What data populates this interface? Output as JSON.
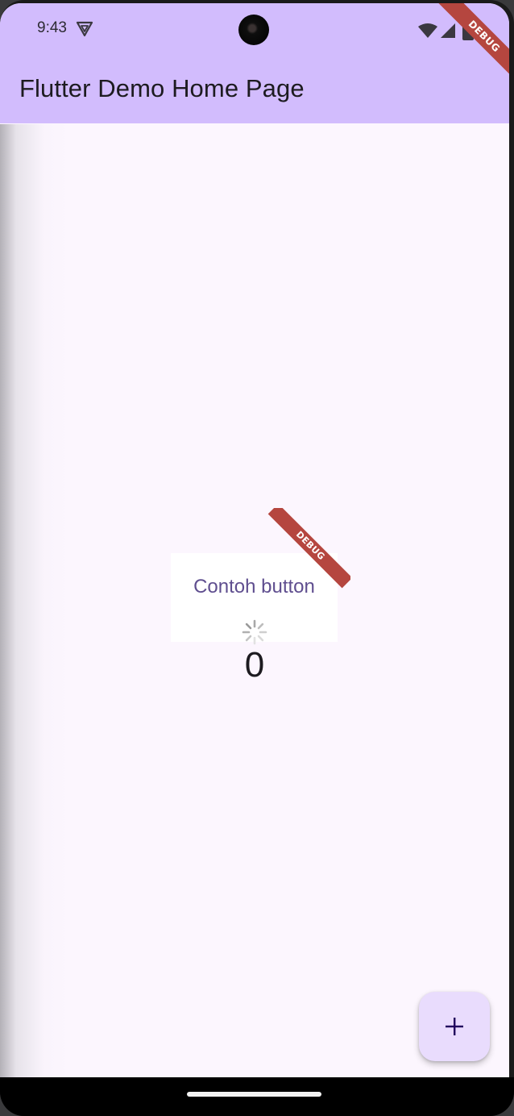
{
  "status_bar": {
    "time": "9:43",
    "icons": [
      "vpn-shield-icon",
      "wifi-icon",
      "cell-signal-icon",
      "battery-icon"
    ]
  },
  "app_bar": {
    "title": "Flutter Demo Home Page",
    "debug_banner": "DEBUG"
  },
  "body": {
    "button_label": "Contoh button",
    "button_debug_banner": "DEBUG",
    "counter_value": "0",
    "loading_indicator": "spinner-icon"
  },
  "fab": {
    "icon": "plus-icon",
    "label": "+"
  },
  "colors": {
    "app_bar": "#d2bcfd",
    "background": "#fcf6fe",
    "button_text": "#5f4e8f",
    "fab": "#e9dcfd",
    "debug_banner": "#b5463f"
  }
}
